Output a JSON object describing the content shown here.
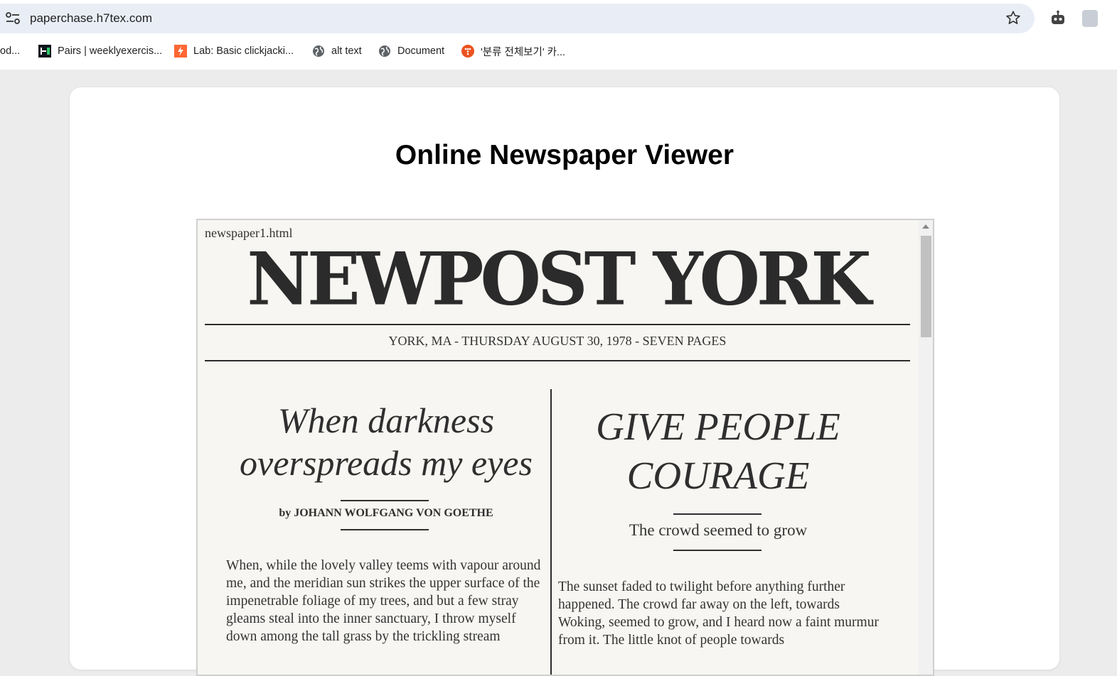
{
  "browser": {
    "url": "paperchase.h7tex.com",
    "bookmarks": [
      {
        "label": "od...",
        "icon": "none"
      },
      {
        "label": "Pairs | weeklyexercis...",
        "icon": "hackerrank-icon"
      },
      {
        "label": "Lab: Basic clickjacki...",
        "icon": "portswigger-icon"
      },
      {
        "label": "alt text",
        "icon": "globe-icon"
      },
      {
        "label": "Document",
        "icon": "globe-icon"
      },
      {
        "label": "'분류 전체보기' 카...",
        "icon": "tistory-icon"
      }
    ]
  },
  "page": {
    "title": "Online Newspaper Viewer"
  },
  "newspaper": {
    "filename": "newspaper1.html",
    "masthead": "NEWPOST YORK",
    "dateline": "YORK, MA - THURSDAY AUGUST 30, 1978 - SEVEN PAGES",
    "article1": {
      "headline_line1": "When darkness",
      "headline_line2": "overspreads my eyes",
      "byline": "by JOHANN WOLFGANG VON GOETHE",
      "body": "When, while the lovely valley teems with vapour around me, and the meridian sun strikes the upper surface of the impenetrable foliage of my trees, and but a few stray gleams steal into the inner sanctuary, I throw myself down among the tall grass by the trickling stream"
    },
    "article2": {
      "headline_line1": "GIVE PEOPLE",
      "headline_line2": "COURAGE",
      "subhead": "The crowd seemed to grow",
      "body": "The sunset faded to twilight before anything further happened. The crowd far away on the left, towards Woking, seemed to grow, and I heard now a faint murmur from it. The little knot of people towards"
    }
  }
}
